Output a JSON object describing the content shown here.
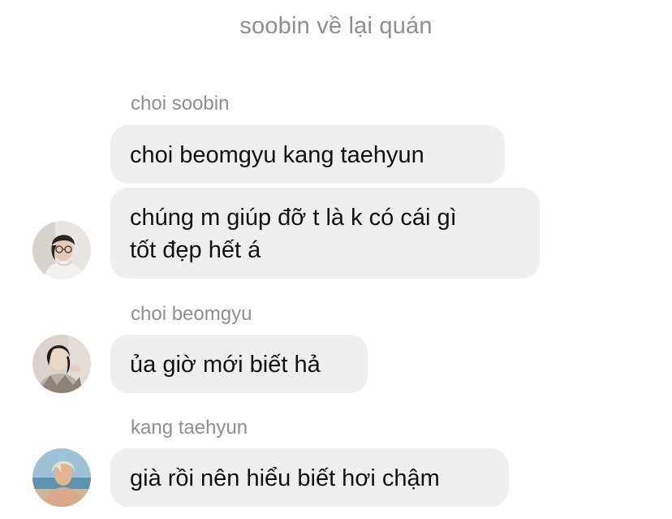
{
  "chat": {
    "title": "soobin về lại quán"
  },
  "messages": [
    {
      "sender": "choi soobin",
      "bubbles": [
        "choi beomgyu kang taehyun",
        "chúng m giúp đỡ t là k có cái gì",
        "tốt đẹp hết á"
      ]
    },
    {
      "sender": "choi beomgyu",
      "bubbles": [
        "ủa giờ mới biết hả"
      ]
    },
    {
      "sender": "kang taehyun",
      "bubbles": [
        "già rồi nên hiểu biết hơi chậm"
      ]
    }
  ],
  "colors": {
    "bubble_bg": "#efefef",
    "meta_text": "#8e8e93",
    "message_text": "#111111"
  }
}
